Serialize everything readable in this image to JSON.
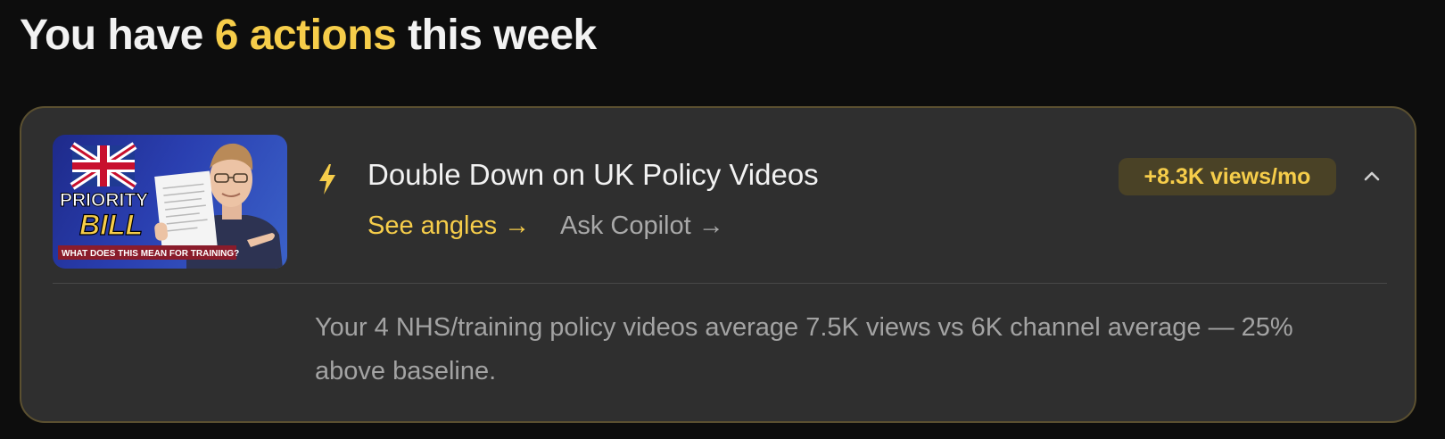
{
  "header": {
    "prefix": "You have",
    "count_label": "6 actions",
    "suffix": "this week"
  },
  "card": {
    "thumbnail": {
      "line1": "PRIORITY",
      "line2": "BILL",
      "caption": "WHAT DOES THIS MEAN FOR TRAINING?",
      "flag": "union-jack-icon"
    },
    "icon": "lightning-bolt-icon",
    "title": "Double Down on UK Policy Videos",
    "badge": "+8.3K views/mo",
    "see_angles": "See angles →",
    "ask_copilot": "Ask Copilot →",
    "collapse_icon": "chevron-up-icon",
    "description": "Your 4 NHS/training policy videos average 7.5K views vs 6K channel average — 25% above baseline."
  },
  "colors": {
    "background": "#0d0d0d",
    "card": "#2f2f2f",
    "accent": "#f6cd4a",
    "card_border": "#5b5030",
    "badge_bg": "#4a4226",
    "muted_text": "#a3a3a3"
  }
}
